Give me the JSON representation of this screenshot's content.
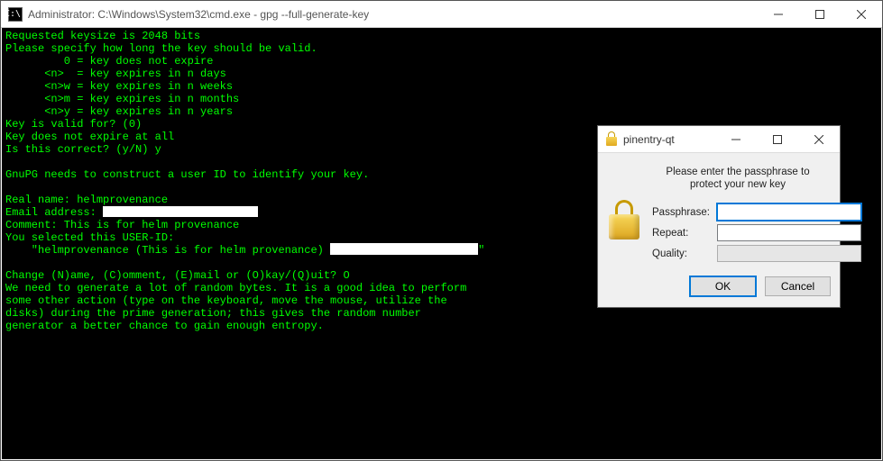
{
  "console": {
    "title": "Administrator: C:\\Windows\\System32\\cmd.exe - gpg  --full-generate-key",
    "icon_glyph": "C:\\.",
    "lines": [
      "Requested keysize is 2048 bits",
      "Please specify how long the key should be valid.",
      "         0 = key does not expire",
      "      <n>  = key expires in n days",
      "      <n>w = key expires in n weeks",
      "      <n>m = key expires in n months",
      "      <n>y = key expires in n years",
      "Key is valid for? (0)",
      "Key does not expire at all",
      "Is this correct? (y/N) y",
      "",
      "GnuPG needs to construct a user ID to identify your key.",
      "",
      "Real name: helmprovenance"
    ],
    "email_label": "Email address: ",
    "lines_mid": [
      "Comment: This is for helm provenance",
      "You selected this USER-ID:"
    ],
    "userid_prefix": "    \"helmprovenance (This is for helm provenance) ",
    "userid_suffix": "\"",
    "lines_after": [
      "",
      "Change (N)ame, (C)omment, (E)mail or (O)kay/(Q)uit? O",
      "We need to generate a lot of random bytes. It is a good idea to perform",
      "some other action (type on the keyboard, move the mouse, utilize the",
      "disks) during the prime generation; this gives the random number",
      "generator a better chance to gain enough entropy."
    ]
  },
  "dialog": {
    "title": "pinentry-qt",
    "message": "Please enter the passphrase to protect your new key",
    "fields": {
      "passphrase_label": "Passphrase:",
      "passphrase_value": "",
      "repeat_label": "Repeat:",
      "repeat_value": "",
      "quality_label": "Quality:"
    },
    "buttons": {
      "ok": "OK",
      "cancel": "Cancel"
    }
  },
  "window_controls": {
    "minimize": "minimize",
    "maximize": "maximize",
    "close": "close"
  }
}
